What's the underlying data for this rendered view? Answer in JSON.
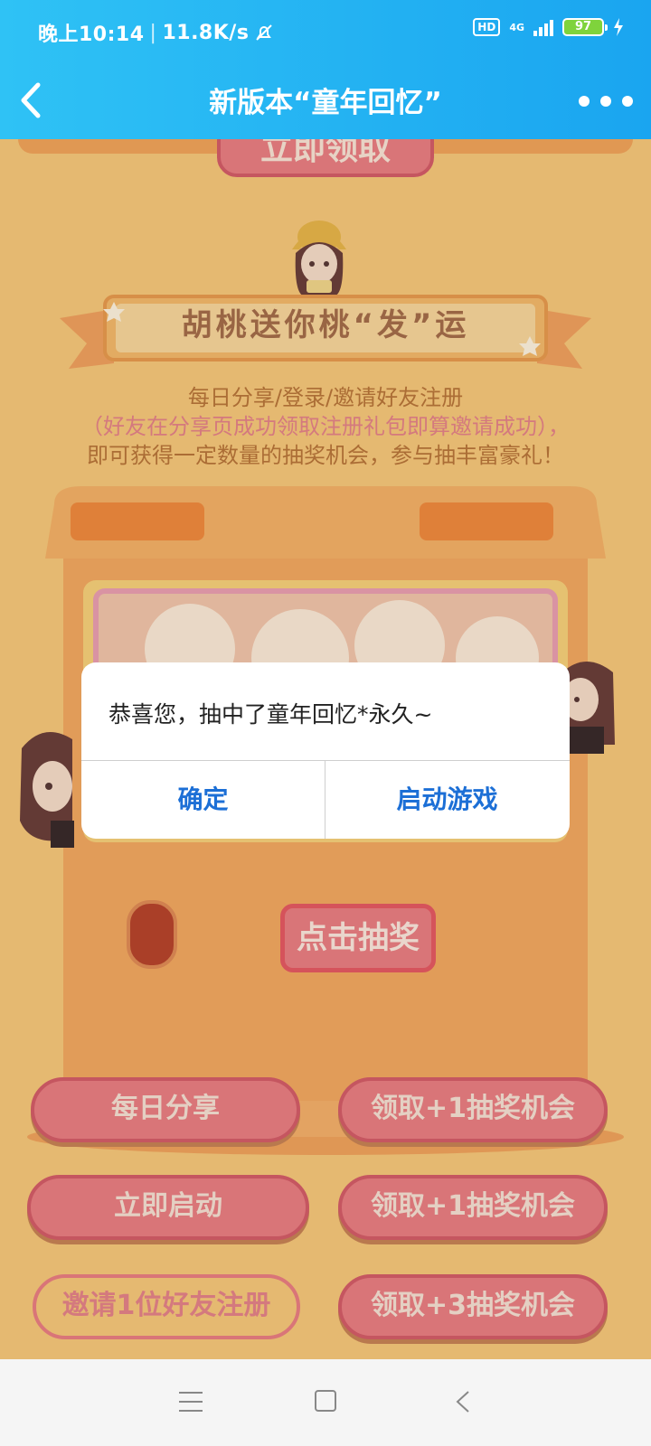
{
  "status_bar": {
    "time": "晚上10:14",
    "speed": "11.8K/s",
    "hd": "HD",
    "network": "4G",
    "battery": "97"
  },
  "header": {
    "title": "新版本“童年回忆”"
  },
  "page": {
    "claim_button": "立即领取",
    "banner": "胡桃送你桃“发”运",
    "desc_line1": "每日分享/登录/邀请好友注册",
    "desc_line2": "（好友在分享页成功领取注册礼包即算邀请成功），",
    "desc_line3": "即可获得一定数量的抽奖机会，参与抽丰富豪礼！",
    "draw_button": "点击抽奖",
    "tasks": [
      {
        "task": "每日分享",
        "reward": "领取+1抽奖机会"
      },
      {
        "task": "立即启动",
        "reward": "领取+1抽奖机会"
      },
      {
        "task": "邀请1位好友注册",
        "reward": "领取+3抽奖机会"
      }
    ]
  },
  "dialog": {
    "message": "恭喜您，抽中了童年回忆*永久~",
    "confirm": "确定",
    "launch": "启动游戏"
  },
  "colors": {
    "header": "#1aa5f0",
    "page_bg": "#f7c77a",
    "pill": "#ea7e82",
    "dialog_button": "#1c6fd6"
  }
}
